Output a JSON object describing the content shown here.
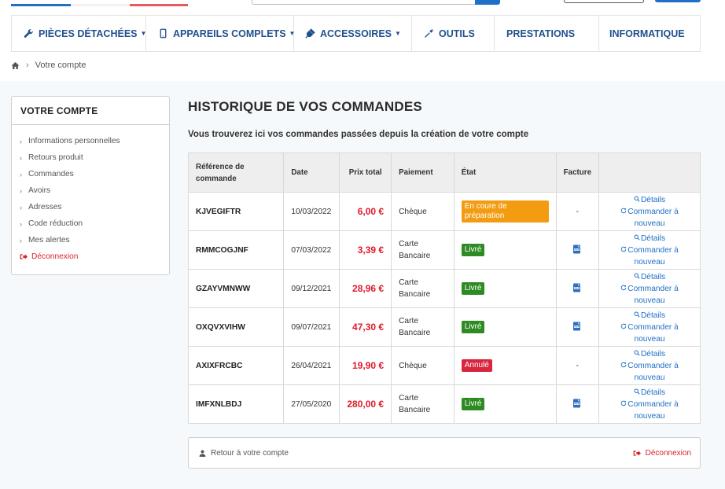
{
  "colors": {
    "nav_text": "#1f4f8f",
    "price_red": "#e0182b",
    "link_blue": "#1f6fc5",
    "logout_red": "#d9252d",
    "status_preparation": "#f39c12",
    "status_livre": "#2e8b24",
    "status_annule": "#d9253e"
  },
  "nav": {
    "items": [
      {
        "label": "PIÈCES DÉTACHÉES",
        "icon": "wrench-icon",
        "dropdown": true
      },
      {
        "label": "APPAREILS COMPLETS",
        "icon": "phone-icon",
        "dropdown": true
      },
      {
        "label": "ACCESSOIRES",
        "icon": "plug-icon",
        "dropdown": true
      },
      {
        "label": "OUTILS",
        "icon": "screwdriver-icon",
        "dropdown": false
      },
      {
        "label": "PRESTATIONS",
        "icon": "",
        "dropdown": false
      },
      {
        "label": "INFORMATIQUE",
        "icon": "",
        "dropdown": false
      }
    ],
    "caret": "▼"
  },
  "breadcrumb": {
    "separator": "›",
    "current": "Votre compte"
  },
  "sidebar": {
    "title": "VOTRE COMPTE",
    "items": [
      "Informations personnelles",
      "Retours produit",
      "Commandes",
      "Avoirs",
      "Adresses",
      "Code réduction",
      "Mes alertes"
    ],
    "logout": "Déconnexion"
  },
  "page": {
    "title": "HISTORIQUE DE VOS COMMANDES",
    "subtitle": "Vous trouverez ici vos commandes passées depuis la création de votre compte"
  },
  "table": {
    "headers": {
      "ref_line1": "Référence de",
      "ref_line2": "commande",
      "date": "Date",
      "total": "Prix total",
      "payment": "Paiement",
      "status": "État",
      "invoice": "Facture"
    },
    "rows": [
      {
        "ref": "KJVEGIFTR",
        "date": "10/03/2022",
        "total": "6,00 €",
        "payment1": "Chèque",
        "payment2": "",
        "status": "En coure de préparation",
        "status_color": "#f39c12",
        "invoice": "-",
        "has_pdf": false
      },
      {
        "ref": "RMMCOGJNF",
        "date": "07/03/2022",
        "total": "3,39 €",
        "payment1": "Carte",
        "payment2": "Bancaire",
        "status": "Livré",
        "status_color": "#2e8b24",
        "invoice": "",
        "has_pdf": true
      },
      {
        "ref": "GZAYVMNWW",
        "date": "09/12/2021",
        "total": "28,96 €",
        "payment1": "Carte",
        "payment2": "Bancaire",
        "status": "Livré",
        "status_color": "#2e8b24",
        "invoice": "",
        "has_pdf": true
      },
      {
        "ref": "OXQVXVIHW",
        "date": "09/07/2021",
        "total": "47,30 €",
        "payment1": "Carte",
        "payment2": "Bancaire",
        "status": "Livré",
        "status_color": "#2e8b24",
        "invoice": "",
        "has_pdf": true
      },
      {
        "ref": "AXIXFRCBC",
        "date": "26/04/2021",
        "total": "19,90 €",
        "payment1": "Chèque",
        "payment2": "",
        "status": "Annulé",
        "status_color": "#d9253e",
        "invoice": "-",
        "has_pdf": false
      },
      {
        "ref": "IMFXNLBDJ",
        "date": "27/05/2020",
        "total": "280,00 €",
        "payment1": "Carte",
        "payment2": "Bancaire",
        "status": "Livré",
        "status_color": "#2e8b24",
        "invoice": "",
        "has_pdf": true
      }
    ],
    "details_label": "Détails",
    "reorder_label": "Commander à nouveau"
  },
  "footer": {
    "back_label": "Retour à votre compte",
    "logout_label": "Déconnexion"
  }
}
